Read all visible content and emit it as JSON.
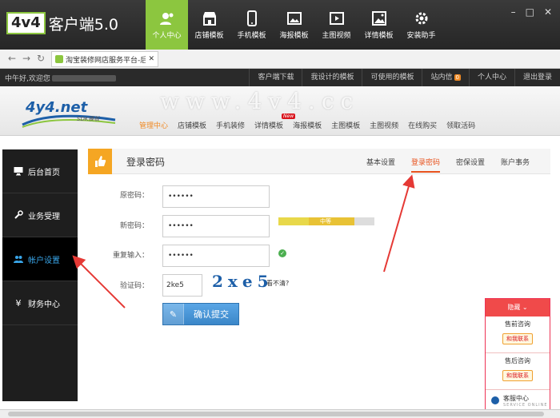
{
  "app": {
    "logo_box": "4v4",
    "logo_text": "客户端5.0"
  },
  "window_controls": [
    "–",
    "□",
    "✕"
  ],
  "nav_tabs": [
    {
      "label": "个人中心",
      "icon": "user-icon"
    },
    {
      "label": "店铺模板",
      "icon": "store-icon"
    },
    {
      "label": "手机模板",
      "icon": "phone-icon"
    },
    {
      "label": "海报模板",
      "icon": "poster-icon"
    },
    {
      "label": "主图视频",
      "icon": "video-icon"
    },
    {
      "label": "详情模板",
      "icon": "image-icon"
    },
    {
      "label": "安装助手",
      "icon": "gear-icon"
    }
  ],
  "browser": {
    "tab_title": "淘宝装修网店服务平台-后台",
    "tab_close": "✕"
  },
  "site_strip": {
    "greeting": "中午好,欢迎您",
    "links": [
      "客户端下载",
      "我设计的模板",
      "可使用的模板",
      "站内信",
      "个人中心",
      "退出登录"
    ],
    "message_count": "0"
  },
  "site_header": {
    "watermark": "www.4v4.cc",
    "logo_main": "4y4.net",
    "logo_sub": "SDK模板",
    "nav": [
      "管理中心",
      "店铺模板",
      "手机装修",
      "详情模板",
      "海报模板",
      "主图模板",
      "主图视频",
      "在线购买",
      "领取活码"
    ],
    "new_badge": "New"
  },
  "sidebar": [
    {
      "label": "后台首页",
      "icon": "monitor-icon"
    },
    {
      "label": "业务受理",
      "icon": "wrench-icon"
    },
    {
      "label": "帐户设置",
      "icon": "users-icon"
    },
    {
      "label": "财务中心",
      "icon": "yen-icon"
    }
  ],
  "main": {
    "title": "登录密码",
    "tabs": [
      "基本设置",
      "登录密码",
      "密保设置",
      "账户事务"
    ],
    "labels": {
      "old": "原密码：",
      "new": "新密码：",
      "repeat": "重复输入：",
      "captcha": "验证码："
    },
    "values": {
      "old": "••••••",
      "new": "••••••",
      "repeat": "••••••",
      "captcha": "2ke5"
    },
    "strength_label": "中等",
    "captcha_image_text": "2xe5",
    "captcha_refresh": "看不清?",
    "submit": "确认提交"
  },
  "service": {
    "hide": "隐藏 ⌄",
    "presale": "售前咨询",
    "aftersale": "售后咨询",
    "contact": "和我联系",
    "center": "客服中心",
    "center_en": "SERVICE ONLINE"
  },
  "colors": {
    "accent_green": "#8cc63f",
    "accent_orange": "#e8531e",
    "arrow_red": "#e53935",
    "button_blue": "#3a86c8"
  }
}
